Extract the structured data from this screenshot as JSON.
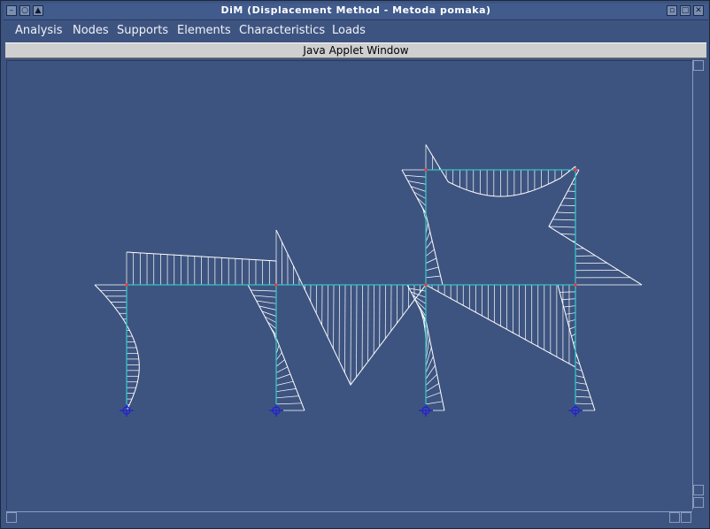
{
  "window": {
    "title": "DiM (Displacement Method - Metoda pomaka)",
    "status": "Java Applet Window"
  },
  "menu": {
    "items": [
      "Analysis",
      "Nodes",
      "Supports",
      "Elements",
      "Characteristics",
      "Loads"
    ]
  },
  "colors": {
    "background": "#3e5480",
    "frame_members": "#33c4c4",
    "diagram_lines": "#ffffff",
    "joints": "#ff3030",
    "supports": "#2020d0"
  },
  "icons": {
    "window_menu": "minus-icon",
    "window_shade": "circle-icon",
    "window_roll": "roll-icon",
    "iconify": "iconify-icon",
    "maximize": "maximize-icon",
    "close": "close-icon"
  }
}
